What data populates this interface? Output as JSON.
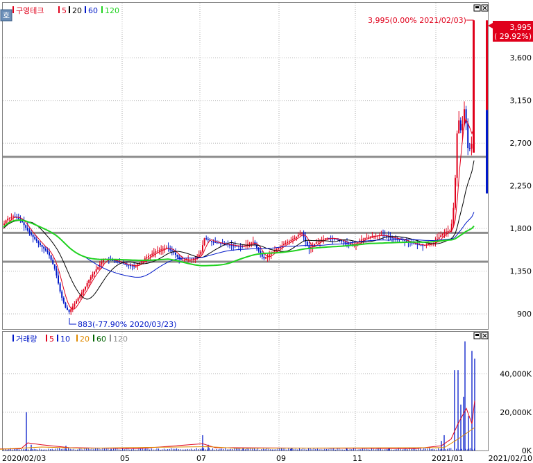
{
  "chart_data": [
    {
      "type": "candlestick",
      "title": "구영테크",
      "legend": [
        {
          "label": "5",
          "color": "#e0001b"
        },
        {
          "label": "20",
          "color": "#000000"
        },
        {
          "label": "60",
          "color": "#0018c8"
        },
        {
          "label": "120",
          "color": "#1fd21f"
        }
      ],
      "yticks": [
        900,
        1350,
        1800,
        2250,
        2700,
        3150,
        3600
      ],
      "ytick_labels": [
        "900",
        "1,350",
        "1,800",
        "2,250",
        "2,700",
        "3,150",
        "3,600"
      ],
      "ylim": [
        740,
        4180
      ],
      "hlines": [
        2555,
        1755,
        1450
      ],
      "last_price": "3,995",
      "last_change": "( 29.92%)",
      "high_annotation": "3,995(0.00% 2021/02/03)",
      "low_annotation": "883(-77.90% 2020/03/23)",
      "price_path": [
        [
          0,
          1770
        ],
        [
          10,
          1900
        ],
        [
          20,
          1930
        ],
        [
          30,
          1890
        ],
        [
          40,
          1780
        ],
        [
          55,
          1650
        ],
        [
          70,
          1540
        ],
        [
          80,
          1360
        ],
        [
          88,
          1100
        ],
        [
          95,
          960
        ],
        [
          100,
          920
        ],
        [
          108,
          1010
        ],
        [
          115,
          1090
        ],
        [
          122,
          1170
        ],
        [
          130,
          1280
        ],
        [
          140,
          1380
        ],
        [
          150,
          1480
        ],
        [
          165,
          1460
        ],
        [
          180,
          1420
        ],
        [
          195,
          1400
        ],
        [
          210,
          1490
        ],
        [
          225,
          1560
        ],
        [
          240,
          1600
        ],
        [
          250,
          1550
        ],
        [
          260,
          1470
        ],
        [
          275,
          1470
        ],
        [
          285,
          1500
        ],
        [
          290,
          1560
        ],
        [
          295,
          1700
        ],
        [
          305,
          1660
        ],
        [
          320,
          1640
        ],
        [
          335,
          1620
        ],
        [
          350,
          1610
        ],
        [
          365,
          1660
        ],
        [
          380,
          1480
        ],
        [
          395,
          1560
        ],
        [
          410,
          1640
        ],
        [
          425,
          1700
        ],
        [
          435,
          1760
        ],
        [
          445,
          1580
        ],
        [
          455,
          1650
        ],
        [
          470,
          1700
        ],
        [
          485,
          1690
        ],
        [
          500,
          1640
        ],
        [
          510,
          1620
        ],
        [
          520,
          1680
        ],
        [
          535,
          1720
        ],
        [
          550,
          1730
        ],
        [
          565,
          1700
        ],
        [
          580,
          1680
        ],
        [
          595,
          1640
        ],
        [
          610,
          1620
        ],
        [
          625,
          1650
        ],
        [
          640,
          1760
        ],
        [
          650,
          1780
        ],
        [
          655,
          2100
        ],
        [
          660,
          3000
        ],
        [
          665,
          2800
        ],
        [
          670,
          3100
        ],
        [
          675,
          2600
        ],
        [
          680,
          2700
        ],
        [
          684,
          3995
        ]
      ]
    },
    {
      "type": "bar",
      "title": "거래량",
      "legend": [
        {
          "label": "5",
          "color": "#e0001b"
        },
        {
          "label": "10",
          "color": "#0018c8"
        },
        {
          "label": "20",
          "color": "#e08a00"
        },
        {
          "label": "60",
          "color": "#006400"
        },
        {
          "label": "120",
          "color": "#909090"
        }
      ],
      "yticks": [
        0,
        20000,
        40000
      ],
      "ytick_labels": [
        "0K",
        "20,000K",
        "40,000K"
      ],
      "ylim": [
        0,
        62000
      ],
      "spikes": [
        [
          38,
          20000
        ],
        [
          45,
          3000
        ],
        [
          95,
          2500
        ],
        [
          160,
          900
        ],
        [
          210,
          1000
        ],
        [
          292,
          8000
        ],
        [
          300,
          3000
        ],
        [
          350,
          1500
        ],
        [
          420,
          1200
        ],
        [
          500,
          1000
        ],
        [
          560,
          900
        ],
        [
          636,
          5000
        ],
        [
          640,
          8000
        ],
        [
          655,
          42000
        ],
        [
          660,
          42000
        ],
        [
          664,
          24000
        ],
        [
          668,
          28000
        ],
        [
          670,
          57000
        ],
        [
          675,
          18000
        ],
        [
          680,
          52000
        ],
        [
          684,
          48000
        ]
      ]
    }
  ],
  "x_axis": {
    "tick_labels": [
      "2020/02/03",
      "05",
      "07",
      "09",
      "11",
      "2021/01",
      "2021/02/10"
    ]
  },
  "colors": {
    "up": "#e0001b",
    "down": "#0018c8",
    "hline": "#8c8c8c",
    "grid": "#b0b0b0"
  },
  "icons": [
    "chart-settings-icon",
    "maximize-icon",
    "close-icon"
  ]
}
